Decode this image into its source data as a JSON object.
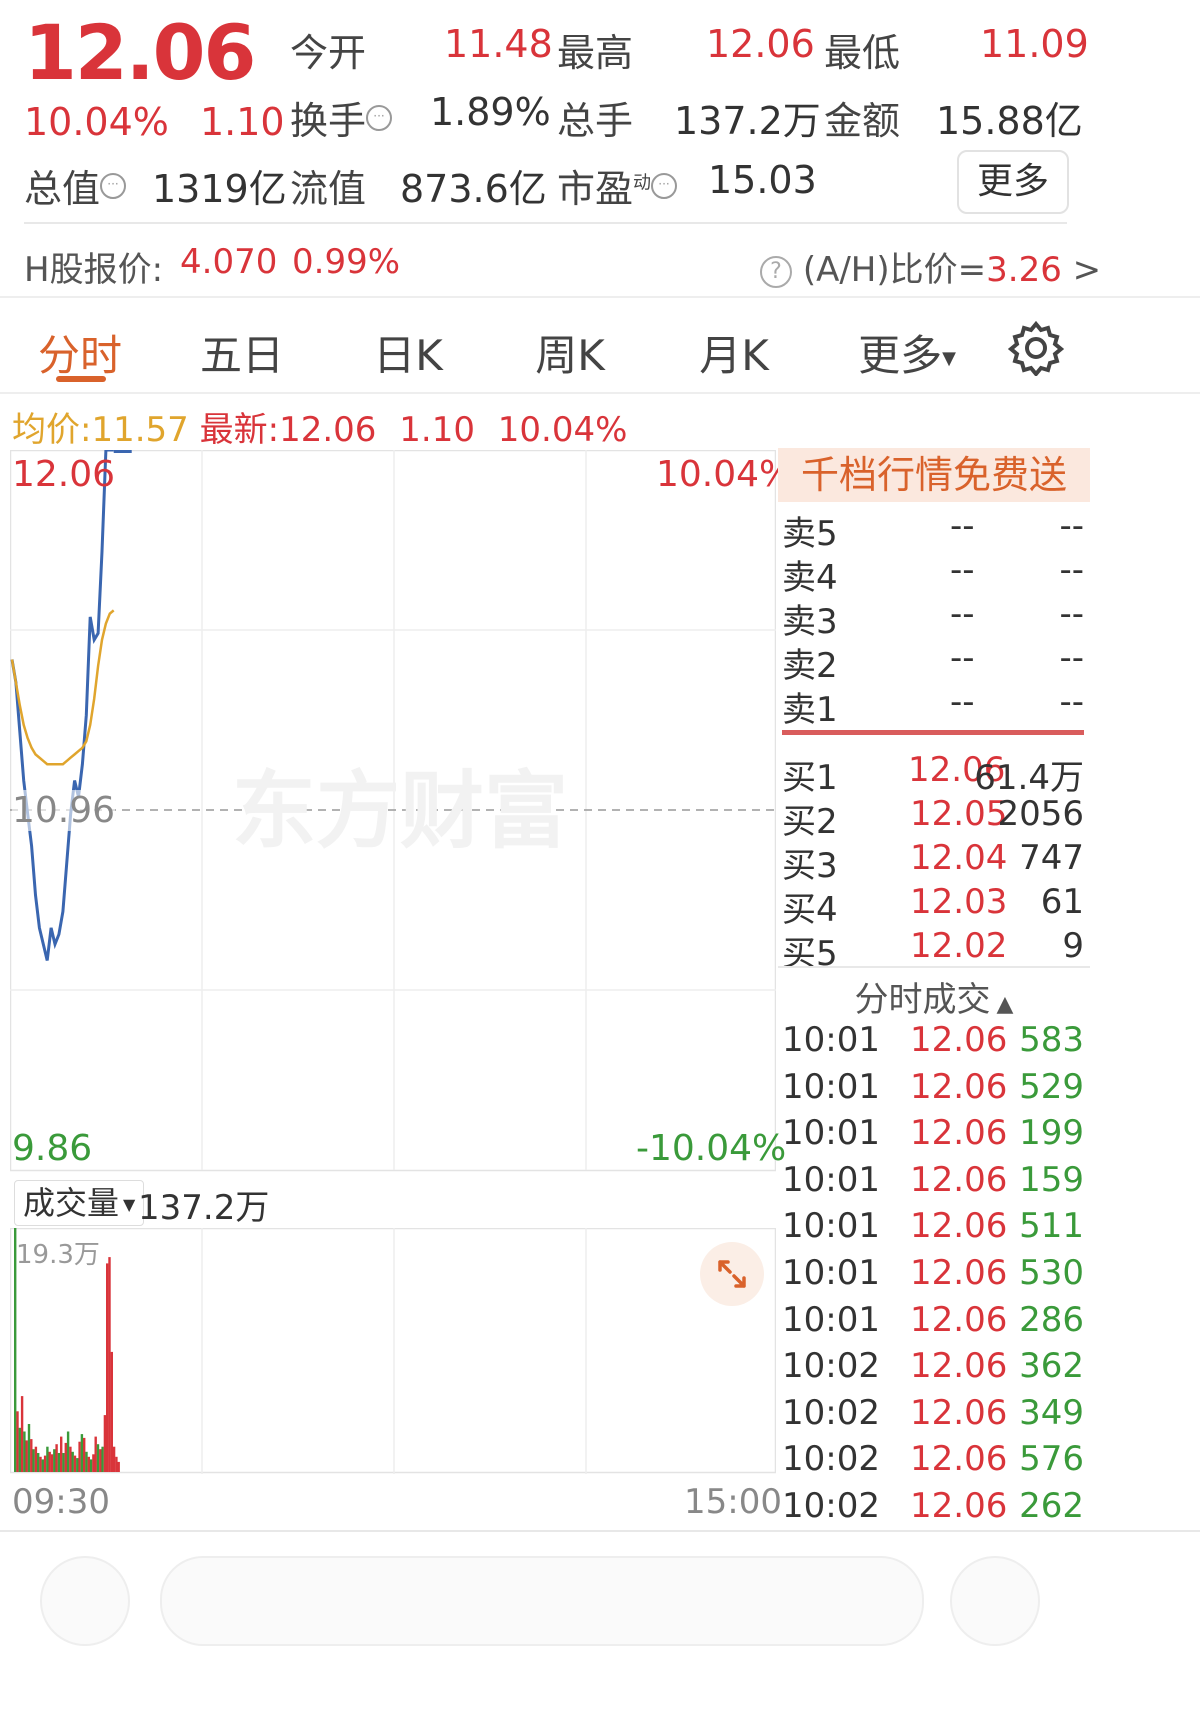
{
  "quote": {
    "price": "12.06",
    "change_pct": "10.04%",
    "change": "1.10"
  },
  "stats": {
    "open_label": "今开",
    "open": "11.48",
    "high_label": "最高",
    "high": "12.06",
    "low_label": "最低",
    "low": "11.09",
    "turnover_label": "换手",
    "turnover": "1.89%",
    "volume_label": "总手",
    "volume": "137.2万",
    "amount_label": "金额",
    "amount": "15.88亿",
    "mktcap_label": "总值",
    "mktcap": "1319亿",
    "float_label": "流值",
    "float": "873.6亿",
    "pe_label": "市盈",
    "pe_sup": "动",
    "pe": "15.03",
    "more_label": "更多"
  },
  "hshare": {
    "label": "H股报价:",
    "price": "4.070",
    "pct": "0.99%",
    "ah_label": "(A/H)比价=",
    "ah_value": "3.26",
    "chevron": ">"
  },
  "tabs": [
    "分时",
    "五日",
    "日K",
    "周K",
    "月K",
    "更多"
  ],
  "tab_active": 0,
  "icons": {
    "settings": "gear-icon",
    "info": "question-circle-icon",
    "expand": "expand-arrows-icon"
  },
  "legend": {
    "avg_label": "均价:",
    "avg": "11.57",
    "last_label": "最新:",
    "last": "12.06",
    "chg": "1.10",
    "chg_pct": "10.04%"
  },
  "chart_axis": {
    "top_price": "12.06",
    "top_pct": "10.04%",
    "mid_price": "10.96",
    "bottom_price": "9.86",
    "bottom_pct": "-10.04%",
    "watermark": "东方财富",
    "time_start": "09:30",
    "time_end": "15:00",
    "volume_selector": "成交量",
    "volume_total": "137.2万",
    "volume_max": "19.3万"
  },
  "colors": {
    "red": "#d9343a",
    "green": "#3a9a3a",
    "gold": "#e0a52d",
    "line": "#3a66b0",
    "accent": "#d9622b"
  },
  "chart_data": [
    {
      "type": "line",
      "title": "",
      "ylim": [
        9.86,
        12.06
      ],
      "series": [
        {
          "name": "最新",
          "values": [
            11.42,
            11.35,
            11.2,
            11.05,
            10.95,
            10.85,
            10.7,
            10.6,
            10.55,
            10.5,
            10.6,
            10.55,
            10.58,
            10.65,
            10.8,
            10.95,
            11.05,
            11.0,
            11.1,
            11.25,
            11.55,
            11.48,
            11.5,
            11.75,
            12.06,
            12.06,
            12.06
          ]
        },
        {
          "name": "均价",
          "values": [
            11.42,
            11.35,
            11.28,
            11.22,
            11.18,
            11.15,
            11.13,
            11.12,
            11.11,
            11.1,
            11.1,
            11.1,
            11.1,
            11.1,
            11.11,
            11.12,
            11.13,
            11.14,
            11.15,
            11.17,
            11.22,
            11.3,
            11.4,
            11.48,
            11.53,
            11.56,
            11.57
          ]
        }
      ]
    },
    {
      "type": "bar",
      "title": "",
      "ylim": [
        0,
        19.3
      ],
      "values": [
        19.3,
        4.8,
        3.5,
        6.0,
        3.2,
        2.5,
        3.8,
        2.6,
        1.8,
        2.0,
        1.5,
        1.2,
        1.0,
        1.3,
        2.0,
        1.6,
        1.4,
        1.8,
        2.2,
        1.5,
        2.8,
        1.5,
        2.3,
        3.2,
        2.0,
        1.6,
        1.3,
        1.1,
        2.4,
        3.0,
        2.7,
        1.6,
        1.2,
        1.0,
        1.4,
        2.8,
        2.2,
        1.8,
        2.0,
        4.5,
        16.5,
        17.0,
        9.5,
        2.0,
        1.2,
        0.8
      ],
      "colors_per_bar": [
        "green",
        "red",
        "green",
        "red",
        "green",
        "red",
        "green",
        "red",
        "green",
        "red",
        "green",
        "red",
        "green",
        "red",
        "green",
        "red",
        "red",
        "green",
        "red",
        "green",
        "red",
        "green",
        "red",
        "green",
        "red",
        "green",
        "red",
        "green",
        "red",
        "green",
        "red",
        "green",
        "red",
        "green",
        "red",
        "red",
        "green",
        "red",
        "green",
        "red",
        "red",
        "red",
        "red",
        "red",
        "red",
        "red"
      ]
    }
  ],
  "orderbook": {
    "banner": "千档行情免费送",
    "sells": [
      {
        "label": "卖5",
        "price": "--",
        "vol": "--"
      },
      {
        "label": "卖4",
        "price": "--",
        "vol": "--"
      },
      {
        "label": "卖3",
        "price": "--",
        "vol": "--"
      },
      {
        "label": "卖2",
        "price": "--",
        "vol": "--"
      },
      {
        "label": "卖1",
        "price": "--",
        "vol": "--"
      }
    ],
    "buys": [
      {
        "label": "买1",
        "price": "12.06",
        "vol": "61.4万"
      },
      {
        "label": "买2",
        "price": "12.05",
        "vol": "2056"
      },
      {
        "label": "买3",
        "price": "12.04",
        "vol": "747"
      },
      {
        "label": "买4",
        "price": "12.03",
        "vol": "61"
      },
      {
        "label": "买5",
        "price": "12.02",
        "vol": "9"
      }
    ]
  },
  "trades": {
    "header": "分时成交",
    "rows": [
      {
        "time": "10:01",
        "price": "12.06",
        "vol": "583"
      },
      {
        "time": "10:01",
        "price": "12.06",
        "vol": "529"
      },
      {
        "time": "10:01",
        "price": "12.06",
        "vol": "199"
      },
      {
        "time": "10:01",
        "price": "12.06",
        "vol": "159"
      },
      {
        "time": "10:01",
        "price": "12.06",
        "vol": "511"
      },
      {
        "time": "10:01",
        "price": "12.06",
        "vol": "530"
      },
      {
        "time": "10:01",
        "price": "12.06",
        "vol": "286"
      },
      {
        "time": "10:02",
        "price": "12.06",
        "vol": "362"
      },
      {
        "time": "10:02",
        "price": "12.06",
        "vol": "349"
      },
      {
        "time": "10:02",
        "price": "12.06",
        "vol": "576"
      },
      {
        "time": "10:02",
        "price": "12.06",
        "vol": "262"
      }
    ]
  }
}
